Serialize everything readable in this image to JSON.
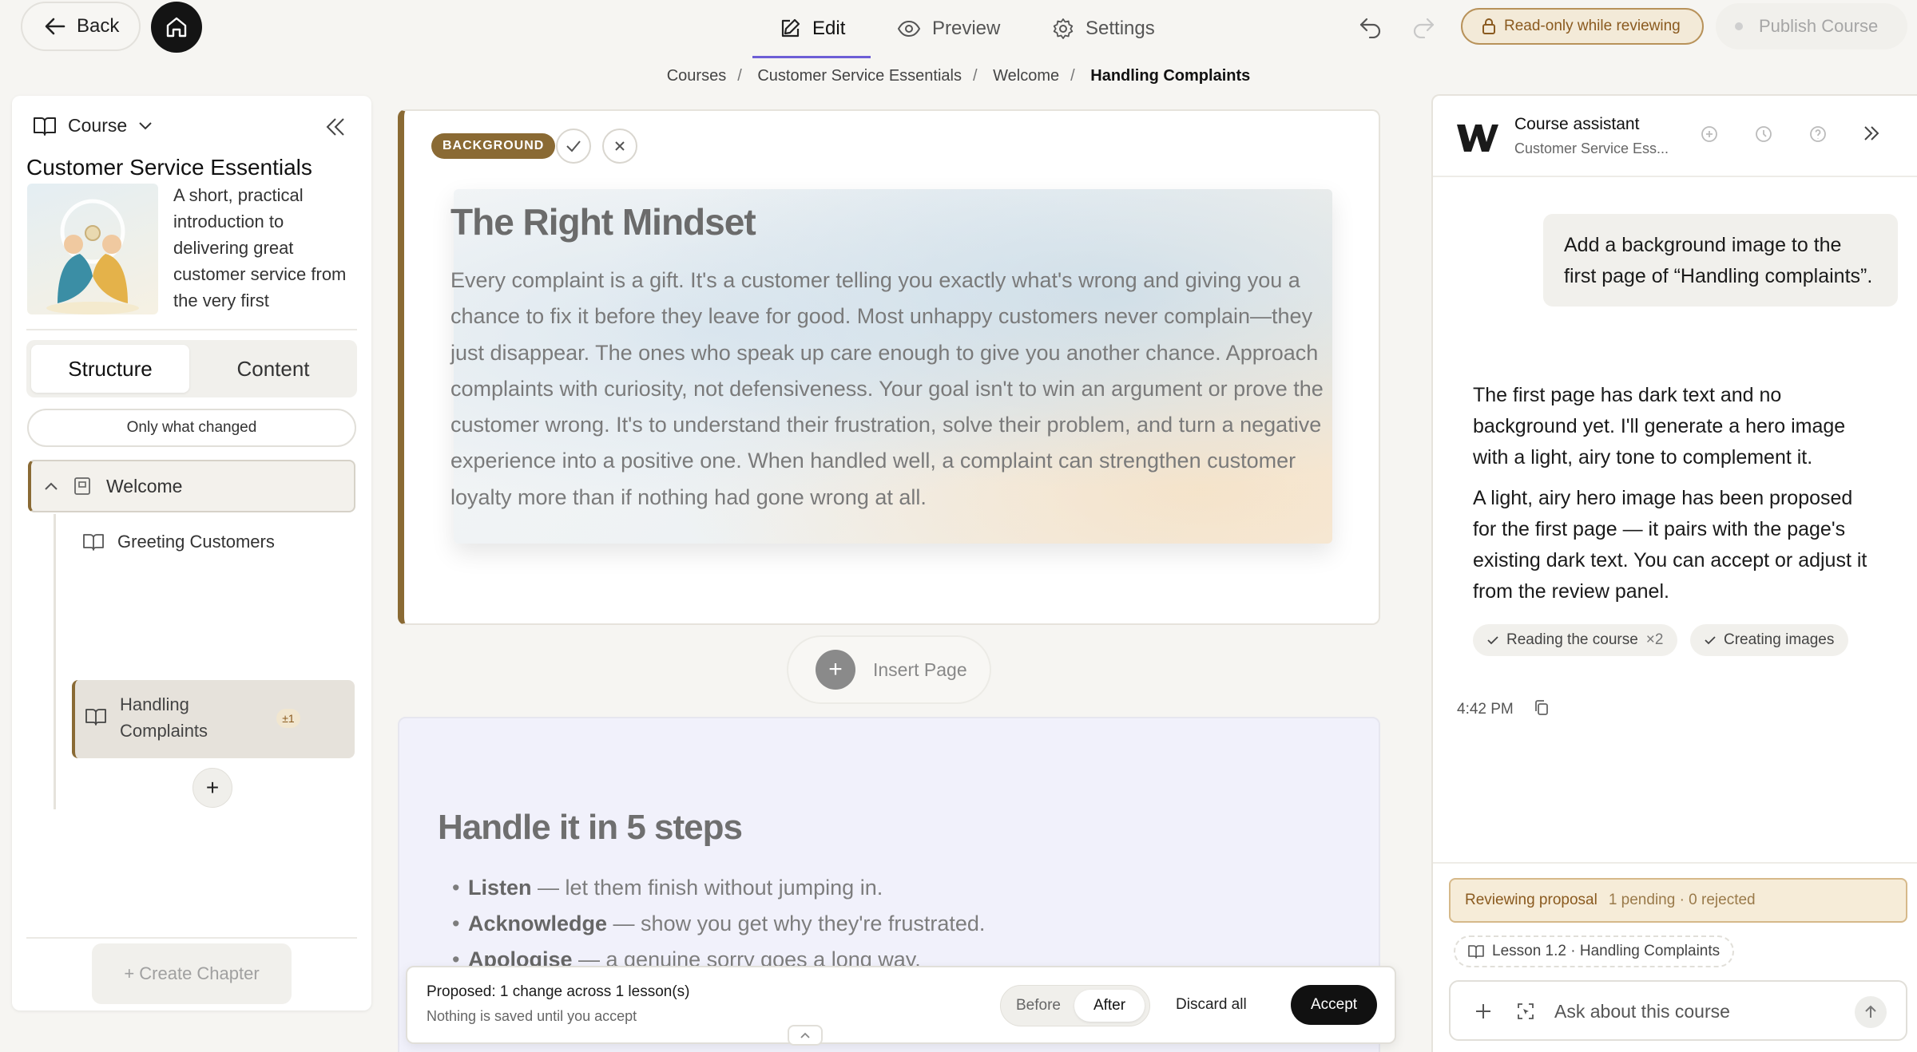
{
  "topbar": {
    "back_label": "Back",
    "tabs": [
      {
        "label": "Edit",
        "active": true
      },
      {
        "label": "Preview",
        "active": false
      },
      {
        "label": "Settings",
        "active": false
      }
    ],
    "readonly_label": "Read-only while reviewing",
    "publish_label": "Publish Course"
  },
  "breadcrumb": [
    "Courses",
    "Customer Service Essentials",
    "Welcome",
    "Handling Complaints"
  ],
  "sidebar": {
    "header_label": "Course",
    "course_title": "Customer Service Essentials",
    "course_description": "A short, practical introduction to delivering great customer service from the very first",
    "tabs": [
      "Structure",
      "Content"
    ],
    "filter_label": "Only what changed",
    "chapter": {
      "label": "Welcome"
    },
    "lessons": [
      {
        "label": "Greeting Customers"
      },
      {
        "label": "Handling Complaints",
        "badge": "±1",
        "active": true
      }
    ],
    "add_label": "+",
    "create_chapter_label": "+ Create Chapter"
  },
  "page1": {
    "tag": "BACKGROUND",
    "title": "The Right Mindset",
    "body": "Every complaint is a gift. It's a customer telling you exactly what's wrong and giving you a chance to fix it before they leave for good. Most unhappy customers never complain—they just disappear. The ones who speak up care enough to give you another chance. Approach complaints with curiosity, not defensiveness. Your goal isn't to win an argument or prove the customer wrong. It's to understand their frustration, solve their problem, and turn a negative experience into a positive one. When handled well, a complaint can strengthen customer loyalty more than if nothing had gone wrong at all."
  },
  "insert_page_label": "Insert Page",
  "page2": {
    "title": "Handle it in 5 steps",
    "steps": [
      {
        "term": "Listen",
        "text": " — let them finish without jumping in."
      },
      {
        "term": "Acknowledge",
        "text": " — show you get why they're frustrated."
      },
      {
        "term": "Apologise",
        "text": " — a genuine sorry goes a long way."
      }
    ]
  },
  "review_bar": {
    "title": "Proposed: 1 change across 1 lesson(s)",
    "subtitle": "Nothing is saved until you accept",
    "before_label": "Before",
    "after_label": "After",
    "discard_label": "Discard all",
    "accept_label": "Accept"
  },
  "assistant": {
    "name": "Course assistant",
    "subtitle": "Customer Service Ess...",
    "user_message": "Add a background image to the first page of “Handling complaints”.",
    "reply_1": "The first page has dark text and no background yet. I'll generate a hero image with a light, airy tone to complement it.",
    "reply_2": "A light, airy hero image has been proposed for the first page — it pairs with the page's existing dark text. You can accept or adjust it from the review panel.",
    "chips": [
      {
        "label": "Reading the course",
        "count": "×2"
      },
      {
        "label": "Creating images",
        "count": ""
      }
    ],
    "time": "4:42 PM",
    "reviewing_label": "Reviewing proposal",
    "reviewing_stats": "1 pending · 0 rejected",
    "lesson_chip": "Lesson 1.2 · Handling Complaints",
    "ask_placeholder": "Ask about this course"
  },
  "colors": {
    "accent_brown": "#8a6a34",
    "edit_underline": "#6d5ed6",
    "readonly_text": "#8a5a1f"
  }
}
